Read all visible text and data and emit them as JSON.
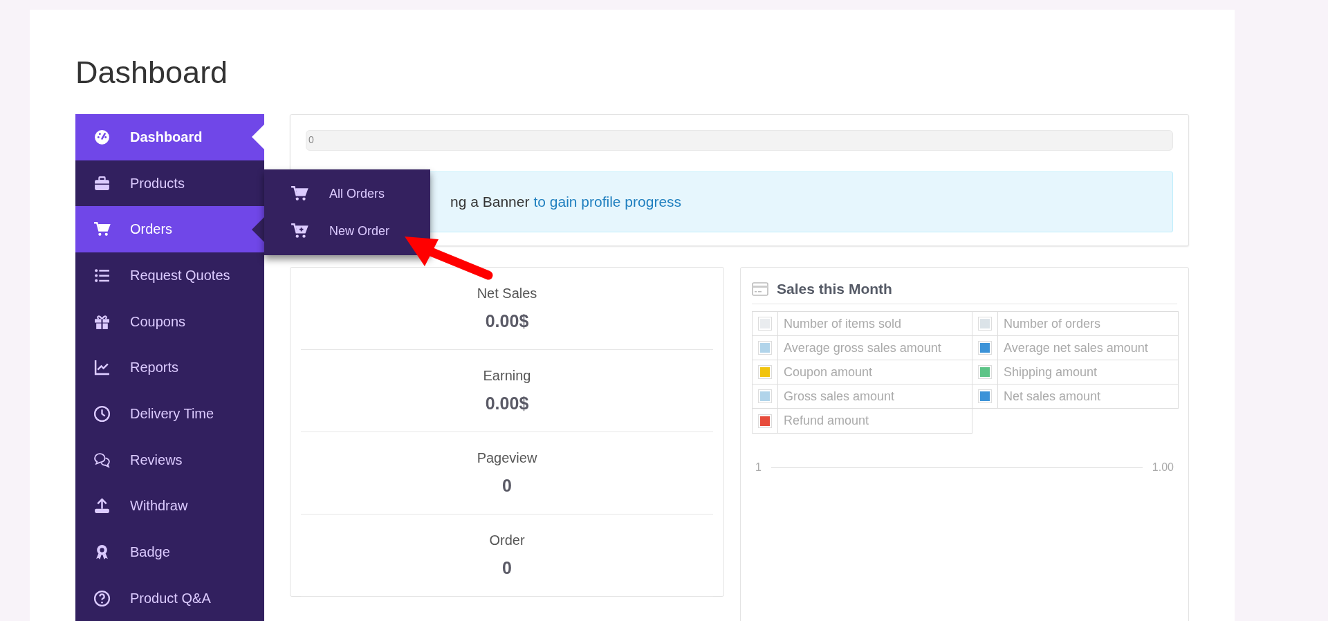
{
  "title": "Dashboard",
  "sidebar": {
    "items": [
      {
        "label": "Dashboard",
        "selected": true,
        "expanded": false
      },
      {
        "label": "Products",
        "selected": false,
        "expanded": false
      },
      {
        "label": "Orders",
        "selected": false,
        "expanded": true,
        "submenu": [
          {
            "label": "All Orders"
          },
          {
            "label": "New Order"
          }
        ]
      },
      {
        "label": "Request Quotes",
        "selected": false,
        "expanded": false
      },
      {
        "label": "Coupons",
        "selected": false,
        "expanded": false
      },
      {
        "label": "Reports",
        "selected": false,
        "expanded": false
      },
      {
        "label": "Delivery Time",
        "selected": false,
        "expanded": false
      },
      {
        "label": "Reviews",
        "selected": false,
        "expanded": false
      },
      {
        "label": "Withdraw",
        "selected": false,
        "expanded": false
      },
      {
        "label": "Badge",
        "selected": false,
        "expanded": false
      },
      {
        "label": "Product Q&A",
        "selected": false,
        "expanded": false
      }
    ]
  },
  "profile_progress": {
    "label": "0",
    "level": 0
  },
  "banner": {
    "text": "ng a Banner",
    "link": "to gain profile progress"
  },
  "stats": [
    {
      "label": "Net Sales",
      "value": "0.00$"
    },
    {
      "label": "Earning",
      "value": "0.00$"
    },
    {
      "label": "Pageview",
      "value": "0"
    },
    {
      "label": "Order",
      "value": "0"
    }
  ],
  "sales_this_month": {
    "title": "Sales this Month",
    "legend": [
      {
        "label": "Number of items sold",
        "color": "#e9ecef"
      },
      {
        "label": "Number of orders",
        "color": "#dbe3e8"
      },
      {
        "label": "Average gross sales amount",
        "color": "#b1d4ea"
      },
      {
        "label": "Average net sales amount",
        "color": "#3c93d8"
      },
      {
        "label": "Coupon amount",
        "color": "#f1c40f"
      },
      {
        "label": "Shipping amount",
        "color": "#5dc487"
      },
      {
        "label": "Gross sales amount",
        "color": "#b1d4ea"
      },
      {
        "label": "Net sales amount",
        "color": "#3c93d8"
      },
      {
        "label": "Refund amount",
        "color": "#e74c3c"
      }
    ],
    "axis_start": "1",
    "axis_end": "1.00"
  }
}
